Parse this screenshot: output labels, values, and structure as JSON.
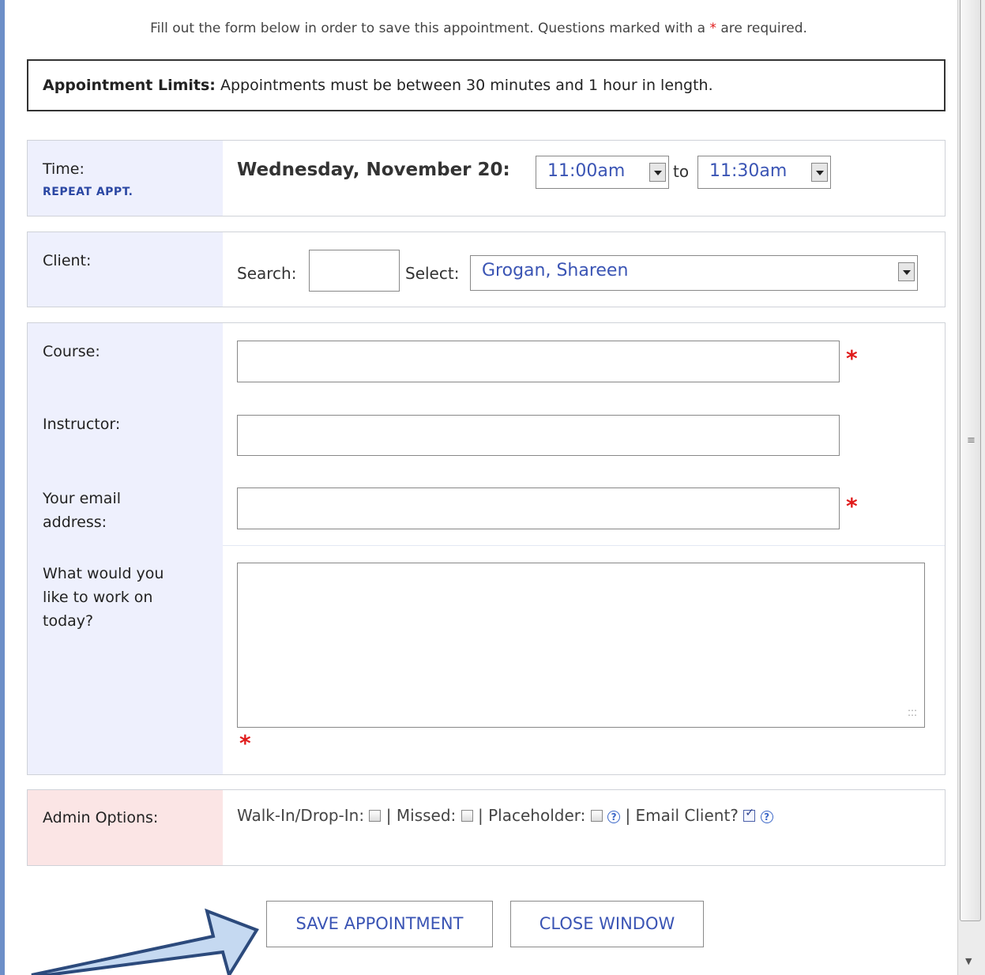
{
  "intro": {
    "text_before": "Fill out the form below in order to save this appointment. Questions marked with a",
    "required_mark": "*",
    "text_after": "are required."
  },
  "limits": {
    "heading": "Appointment Limits:",
    "text": "Appointments must be between 30 minutes and 1 hour in length."
  },
  "time": {
    "label": "Time:",
    "repeat_link": "REPEAT APPT.",
    "date": "Wednesday, November 20:",
    "start": "11:00am",
    "to": "to",
    "end": "11:30am"
  },
  "client": {
    "label": "Client:",
    "search_label": "Search:",
    "search_value": "",
    "select_label": "Select:",
    "selected": "Grogan, Shareen"
  },
  "details": {
    "course_label": "Course:",
    "instructor_label": "Instructor:",
    "email_label_line1": "Your email",
    "email_label_line2": "address:",
    "work_label_line1": "What would you",
    "work_label_line2": "like to work on",
    "work_label_line3": "today?",
    "required_mark": "*"
  },
  "admin": {
    "label": "Admin Options:",
    "walkin_label": "Walk-In/Drop-In:",
    "walkin_checked": false,
    "missed_label": "| Missed:",
    "missed_checked": false,
    "placeholder_label": "| Placeholder:",
    "placeholder_checked": false,
    "email_label": "| Email Client?",
    "email_checked": true,
    "help_glyph": "?"
  },
  "buttons": {
    "save": "SAVE APPOINTMENT",
    "close": "CLOSE WINDOW"
  },
  "colors": {
    "label_bg": "#eef0fd",
    "admin_bg": "#fbe5e5",
    "link_blue": "#3a54b4",
    "required_red": "#e01b1b",
    "annotation_arrow_fill": "#c5d9f1",
    "annotation_arrow_stroke": "#2c4a7c"
  },
  "icons": [
    "dropdown-arrow-icon",
    "help-icon",
    "checkbox-icon",
    "resize-grip-icon",
    "annotation-arrow-icon"
  ]
}
